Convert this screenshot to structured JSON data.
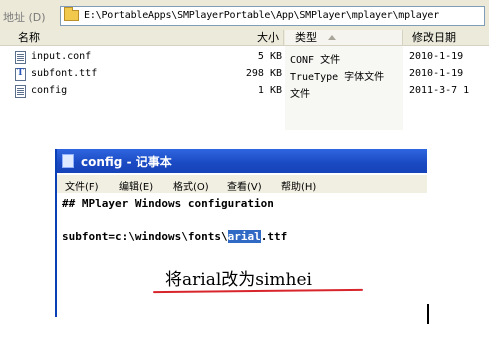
{
  "address_bar": {
    "label": "地址 (D)",
    "path": "E:\\PortableApps\\SMPlayerPortable\\App\\SMPlayer\\mplayer\\mplayer"
  },
  "columns": {
    "name": "名称",
    "size": "大小",
    "type": "类型",
    "date": "修改日期"
  },
  "files": [
    {
      "name": "input.conf",
      "size": "5 KB",
      "type": "CONF 文件",
      "date": "2010-1-19",
      "icon": "text-file-icon"
    },
    {
      "name": "subfont.ttf",
      "size": "298 KB",
      "type": "TrueType 字体文件",
      "date": "2010-1-19",
      "icon": "font-file-icon"
    },
    {
      "name": "config",
      "size": "1 KB",
      "type": "文件",
      "date": "2011-3-7 1",
      "icon": "text-file-icon"
    }
  ],
  "notepad": {
    "title": "config - 记事本",
    "menu": [
      "文件(F)",
      "编辑(E)",
      "格式(O)",
      "查看(V)",
      "帮助(H)"
    ],
    "line1": "## MPlayer Windows configuration",
    "line2_prefix": "subfont=c:\\windows\\fonts\\",
    "line2_selected": "arial",
    "line2_suffix": ".ttf"
  },
  "annotation": "将arial改为simhei",
  "colors": {
    "titlebar": "#1a49c2",
    "selection": "#316ac5",
    "underline": "#d8252c"
  }
}
